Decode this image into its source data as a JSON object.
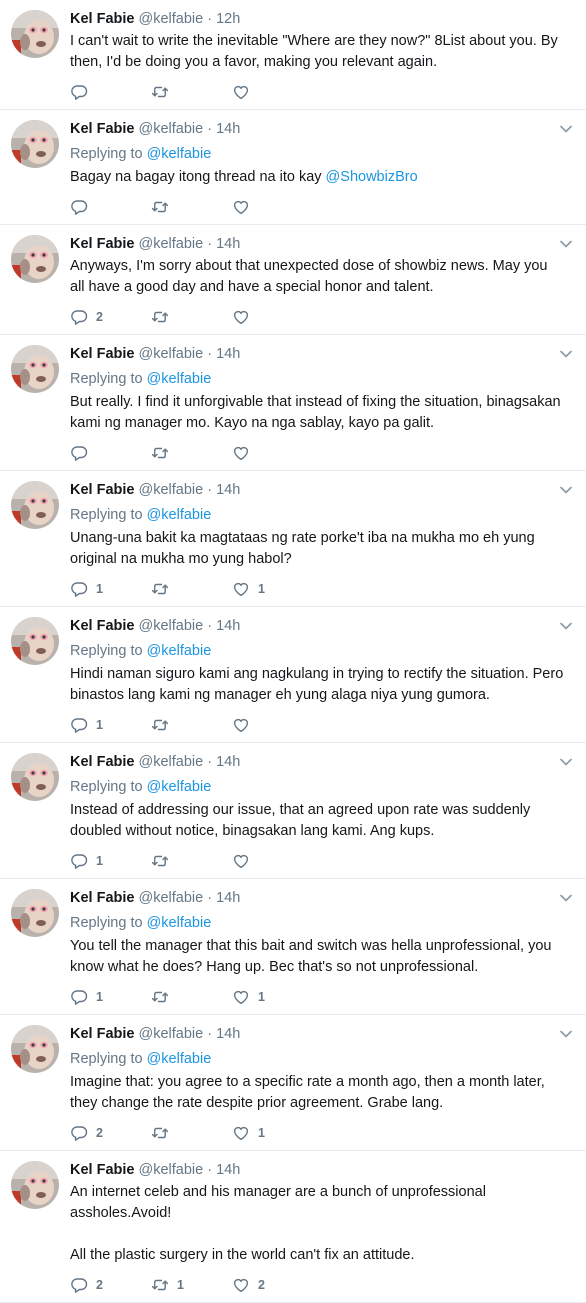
{
  "icons": {
    "reply": "reply-icon",
    "retweet": "retweet-icon",
    "like": "heart-icon",
    "menu": "chevron-down-icon"
  },
  "colors": {
    "link": "#1b95e0",
    "secondary": "#657786",
    "text": "#14171a",
    "border": "#e6ecf0"
  },
  "tweets": [
    {
      "name": "Kel Fabie",
      "handle": "@kelfabie",
      "time": "12h",
      "show_caret": false,
      "replying_to": null,
      "paragraphs": [
        [
          {
            "t": "I can't wait to write the inevitable \"Where are they now?\" 8List about you. By then, I'd be doing you a favor, making you relevant again."
          }
        ]
      ],
      "replies": "",
      "retweets": "",
      "likes": ""
    },
    {
      "name": "Kel Fabie",
      "handle": "@kelfabie",
      "time": "14h",
      "show_caret": true,
      "replying_to": "@kelfabie",
      "paragraphs": [
        [
          {
            "t": "Bagay na bagay itong thread na ito kay "
          },
          {
            "t": "@ShowbizBro",
            "link": true
          }
        ]
      ],
      "replies": "",
      "retweets": "",
      "likes": ""
    },
    {
      "name": "Kel Fabie",
      "handle": "@kelfabie",
      "time": "14h",
      "show_caret": true,
      "replying_to": null,
      "paragraphs": [
        [
          {
            "t": "Anyways, I'm sorry about that unexpected dose of showbiz news. May you all have a good day and have a special honor and talent."
          }
        ]
      ],
      "replies": "2",
      "retweets": "",
      "likes": ""
    },
    {
      "name": "Kel Fabie",
      "handle": "@kelfabie",
      "time": "14h",
      "show_caret": true,
      "replying_to": "@kelfabie",
      "paragraphs": [
        [
          {
            "t": "But really. I find it unforgivable that instead of fixing the situation, binagsakan kami ng manager mo. Kayo na nga sablay, kayo pa galit."
          }
        ]
      ],
      "replies": "",
      "retweets": "",
      "likes": ""
    },
    {
      "name": "Kel Fabie",
      "handle": "@kelfabie",
      "time": "14h",
      "show_caret": true,
      "replying_to": "@kelfabie",
      "paragraphs": [
        [
          {
            "t": "Unang-una bakit ka magtataas ng rate porke't iba na mukha mo eh yung original na mukha mo yung habol?"
          }
        ]
      ],
      "replies": "1",
      "retweets": "",
      "likes": "1"
    },
    {
      "name": "Kel Fabie",
      "handle": "@kelfabie",
      "time": "14h",
      "show_caret": true,
      "replying_to": "@kelfabie",
      "paragraphs": [
        [
          {
            "t": "Hindi naman siguro kami ang nagkulang in trying to rectify the situation. Pero binastos lang kami ng manager eh yung alaga niya yung gumora."
          }
        ]
      ],
      "replies": "1",
      "retweets": "",
      "likes": ""
    },
    {
      "name": "Kel Fabie",
      "handle": "@kelfabie",
      "time": "14h",
      "show_caret": true,
      "replying_to": "@kelfabie",
      "paragraphs": [
        [
          {
            "t": "Instead of addressing our issue, that an agreed upon rate was suddenly doubled without notice, binagsakan lang kami. Ang kups."
          }
        ]
      ],
      "replies": "1",
      "retweets": "",
      "likes": ""
    },
    {
      "name": "Kel Fabie",
      "handle": "@kelfabie",
      "time": "14h",
      "show_caret": true,
      "replying_to": "@kelfabie",
      "paragraphs": [
        [
          {
            "t": "You tell the manager that this bait and switch was hella unprofessional, you know what he does? Hang up. Bec that's so not unprofessional."
          }
        ]
      ],
      "replies": "1",
      "retweets": "",
      "likes": "1"
    },
    {
      "name": "Kel Fabie",
      "handle": "@kelfabie",
      "time": "14h",
      "show_caret": true,
      "replying_to": "@kelfabie",
      "paragraphs": [
        [
          {
            "t": "Imagine that: you agree to a specific rate a month ago, then a month later, they change the rate despite prior agreement. Grabe lang."
          }
        ]
      ],
      "replies": "2",
      "retweets": "",
      "likes": "1"
    },
    {
      "name": "Kel Fabie",
      "handle": "@kelfabie",
      "time": "14h",
      "show_caret": false,
      "replying_to": null,
      "paragraphs": [
        [
          {
            "t": "An internet celeb and his manager are a bunch of unprofessional assholes.Avoid!"
          }
        ],
        [
          {
            "t": "All the plastic surgery in the world can't fix an attitude."
          }
        ]
      ],
      "replies": "2",
      "retweets": "1",
      "likes": "2"
    }
  ]
}
